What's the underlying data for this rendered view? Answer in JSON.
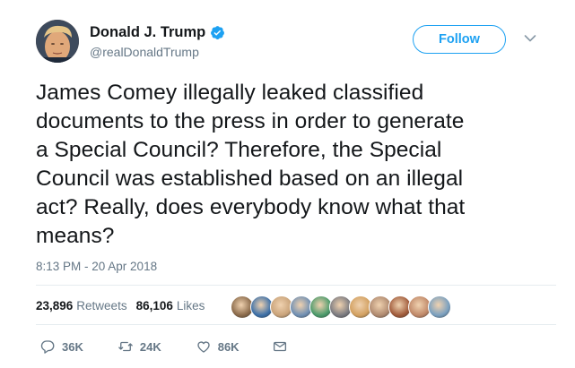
{
  "author": {
    "name": "Donald J. Trump",
    "handle": "@realDonaldTrump",
    "verified_icon": "verified-badge-icon"
  },
  "follow_button_label": "Follow",
  "tweet_text": "James Comey illegally leaked classified\ndocuments to the press in order to generate\na Special Council? Therefore, the Special\nCouncil was established based on an illegal\nact? Really, does everybody know what that\nmeans?",
  "timestamp": "8:13 PM - 20 Apr 2018",
  "stats": {
    "retweets_count": "23,896",
    "retweets_label": "Retweets",
    "likes_count": "86,106",
    "likes_label": "Likes"
  },
  "liker_avatars": [
    "#8a6a4a",
    "#3b6fa8",
    "#c9a37a",
    "#6f8fb3",
    "#4a9a6a",
    "#7a7a80",
    "#d2a060",
    "#b08a70",
    "#a05a3a",
    "#c08868",
    "#7aa0c0"
  ],
  "actions": {
    "reply_count": "36K",
    "retweet_count": "24K",
    "like_count": "86K"
  },
  "colors": {
    "accent": "#1da1f2",
    "secondary_text": "#657786",
    "primary_text": "#14171a"
  }
}
